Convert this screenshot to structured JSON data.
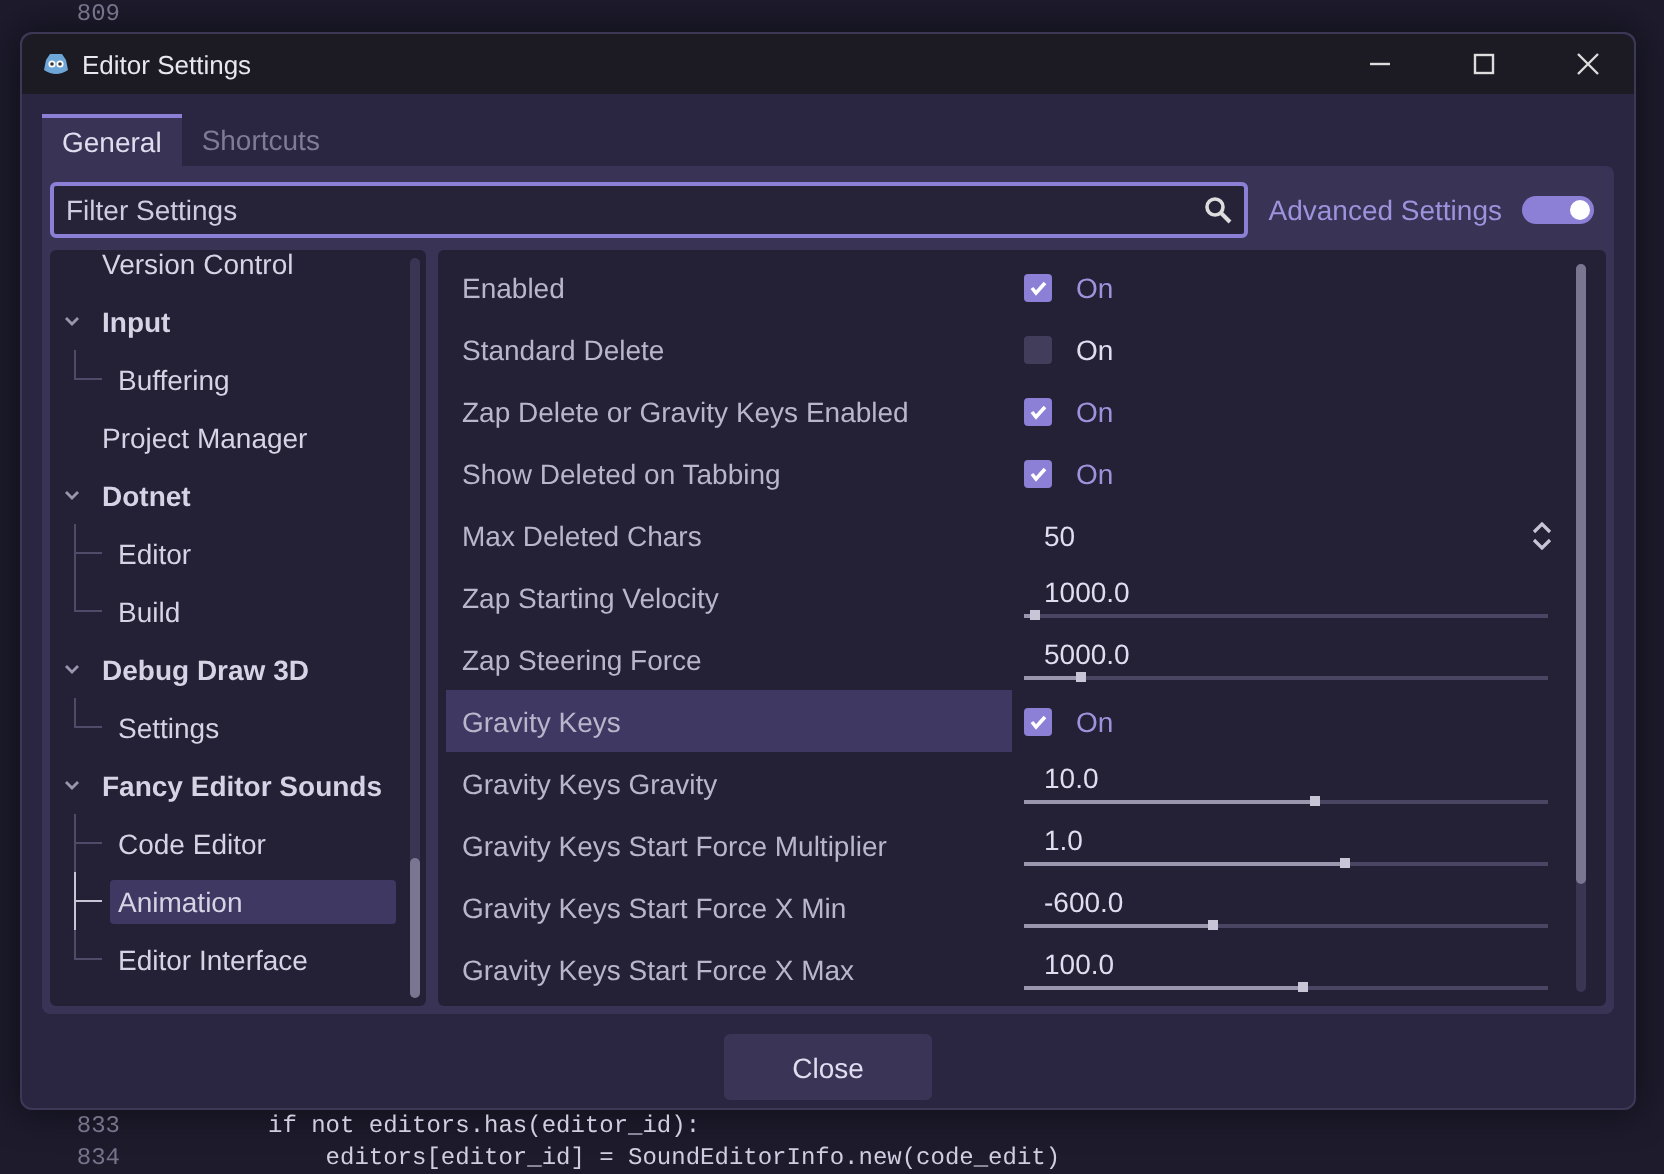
{
  "background_code": [
    {
      "line": "809"
    },
    {
      "line": "833",
      "code": "if not editors.has(editor_id):"
    },
    {
      "line": "834",
      "code": "    editors[editor_id] = SoundEditorInfo.new(code_edit)"
    }
  ],
  "window": {
    "title": "Editor Settings"
  },
  "tabs": [
    {
      "label": "General",
      "selected": true
    },
    {
      "label": "Shortcuts",
      "selected": false
    }
  ],
  "search": {
    "placeholder": "Filter Settings"
  },
  "advanced_settings": {
    "label": "Advanced Settings",
    "on": true
  },
  "sidebar": {
    "items": [
      {
        "label": "Version Control",
        "selected": false
      },
      {
        "label": "Input",
        "expanded": true,
        "selected": false,
        "children": [
          {
            "label": "Buffering",
            "selected": false
          }
        ]
      },
      {
        "label": "Project Manager",
        "selected": false
      },
      {
        "label": "Dotnet",
        "expanded": true,
        "selected": false,
        "children": [
          {
            "label": "Editor",
            "selected": false
          },
          {
            "label": "Build",
            "selected": false
          }
        ]
      },
      {
        "label": "Debug Draw 3D",
        "expanded": true,
        "selected": false,
        "children": [
          {
            "label": "Settings",
            "selected": false
          }
        ]
      },
      {
        "label": "Fancy Editor Sounds",
        "expanded": true,
        "selected": false,
        "children": [
          {
            "label": "Code Editor",
            "selected": false
          },
          {
            "label": "Animation",
            "selected": true
          },
          {
            "label": "Editor Interface",
            "selected": false
          }
        ]
      }
    ]
  },
  "settings": [
    {
      "name": "Enabled",
      "kind": "checkbox",
      "checked": true,
      "value": "On",
      "selected": false
    },
    {
      "name": "Standard Delete",
      "kind": "checkbox",
      "checked": false,
      "value": "On",
      "selected": false
    },
    {
      "name": "Zap Delete or Gravity Keys Enabled",
      "kind": "checkbox",
      "checked": true,
      "value": "On",
      "selected": false
    },
    {
      "name": "Show Deleted on Tabbing",
      "kind": "checkbox",
      "checked": true,
      "value": "On",
      "selected": false
    },
    {
      "name": "Max Deleted Chars",
      "kind": "spin",
      "value": "50",
      "selected": false
    },
    {
      "name": "Zap Starting Velocity",
      "kind": "slider",
      "value": "1000.0",
      "level": 0.02,
      "selected": false
    },
    {
      "name": "Zap Steering Force",
      "kind": "slider",
      "value": "5000.0",
      "level": 0.105,
      "selected": false
    },
    {
      "name": "Gravity Keys",
      "kind": "checkbox",
      "checked": true,
      "value": "On",
      "selected": true
    },
    {
      "name": "Gravity Keys Gravity",
      "kind": "slider",
      "value": "10.0",
      "level": 0.555,
      "selected": false
    },
    {
      "name": "Gravity Keys Start Force Multiplier",
      "kind": "slider",
      "value": "1.0",
      "level": 0.61,
      "selected": false
    },
    {
      "name": "Gravity Keys Start Force X Min",
      "kind": "slider",
      "value": "-600.0",
      "level": 0.36,
      "selected": false
    },
    {
      "name": "Gravity Keys Start Force X Max",
      "kind": "slider",
      "value": "100.0",
      "level": 0.53,
      "selected": false
    }
  ],
  "buttons": [
    "Close"
  ]
}
